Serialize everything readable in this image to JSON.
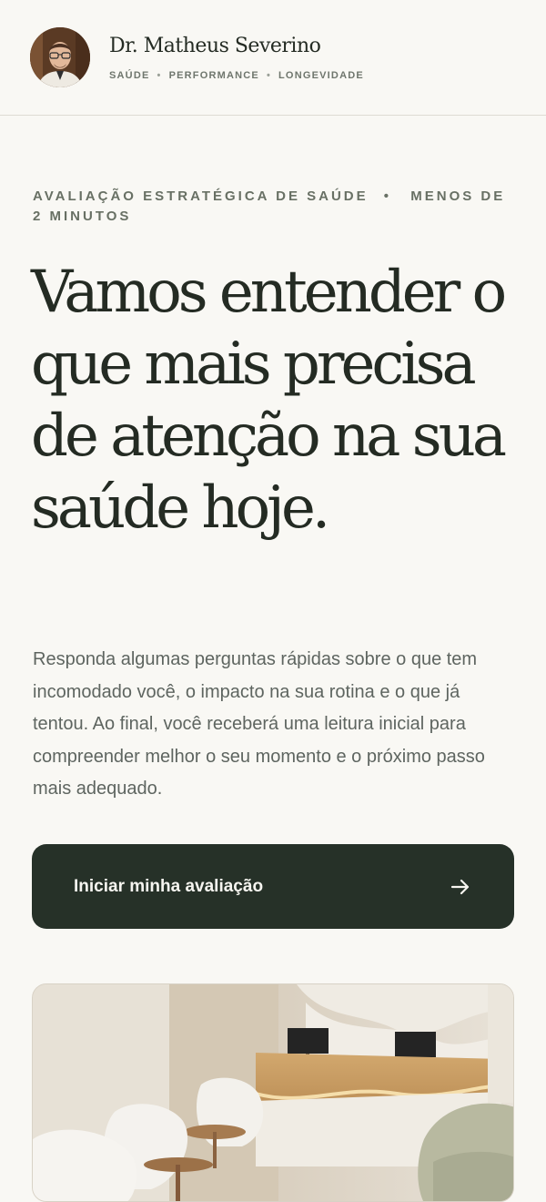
{
  "header": {
    "avatar_alt": "Dr. Matheus Severino",
    "name": "Dr. Matheus Severino",
    "tags": [
      "SAÚDE",
      "PERFORMANCE",
      "LONGEVIDADE"
    ]
  },
  "hero": {
    "eyebrow_part1": "AVALIAÇÃO ESTRATÉGICA DE SAÚDE",
    "eyebrow_separator": "•",
    "eyebrow_part2": "MENOS DE 2 MINUTOS",
    "headline": "Vamos entender o que mais precisa de atenção na sua saúde hoje.",
    "lead": "Responda algumas perguntas rápidas sobre o que tem incomodado você, o impacto na sua rotina e o que já tentou. Ao final, você receberá uma leitura inicial para compreender melhor o seu momento e o próximo passo mais adequado.",
    "cta_label": "Iniciar minha avaliação",
    "cta_icon": "arrow-right-icon"
  },
  "colors": {
    "background": "#f9f8f4",
    "text_dark": "#242b23",
    "muted": "#687064",
    "cta_bg": "#263128",
    "cta_text": "#f6f5f0"
  }
}
